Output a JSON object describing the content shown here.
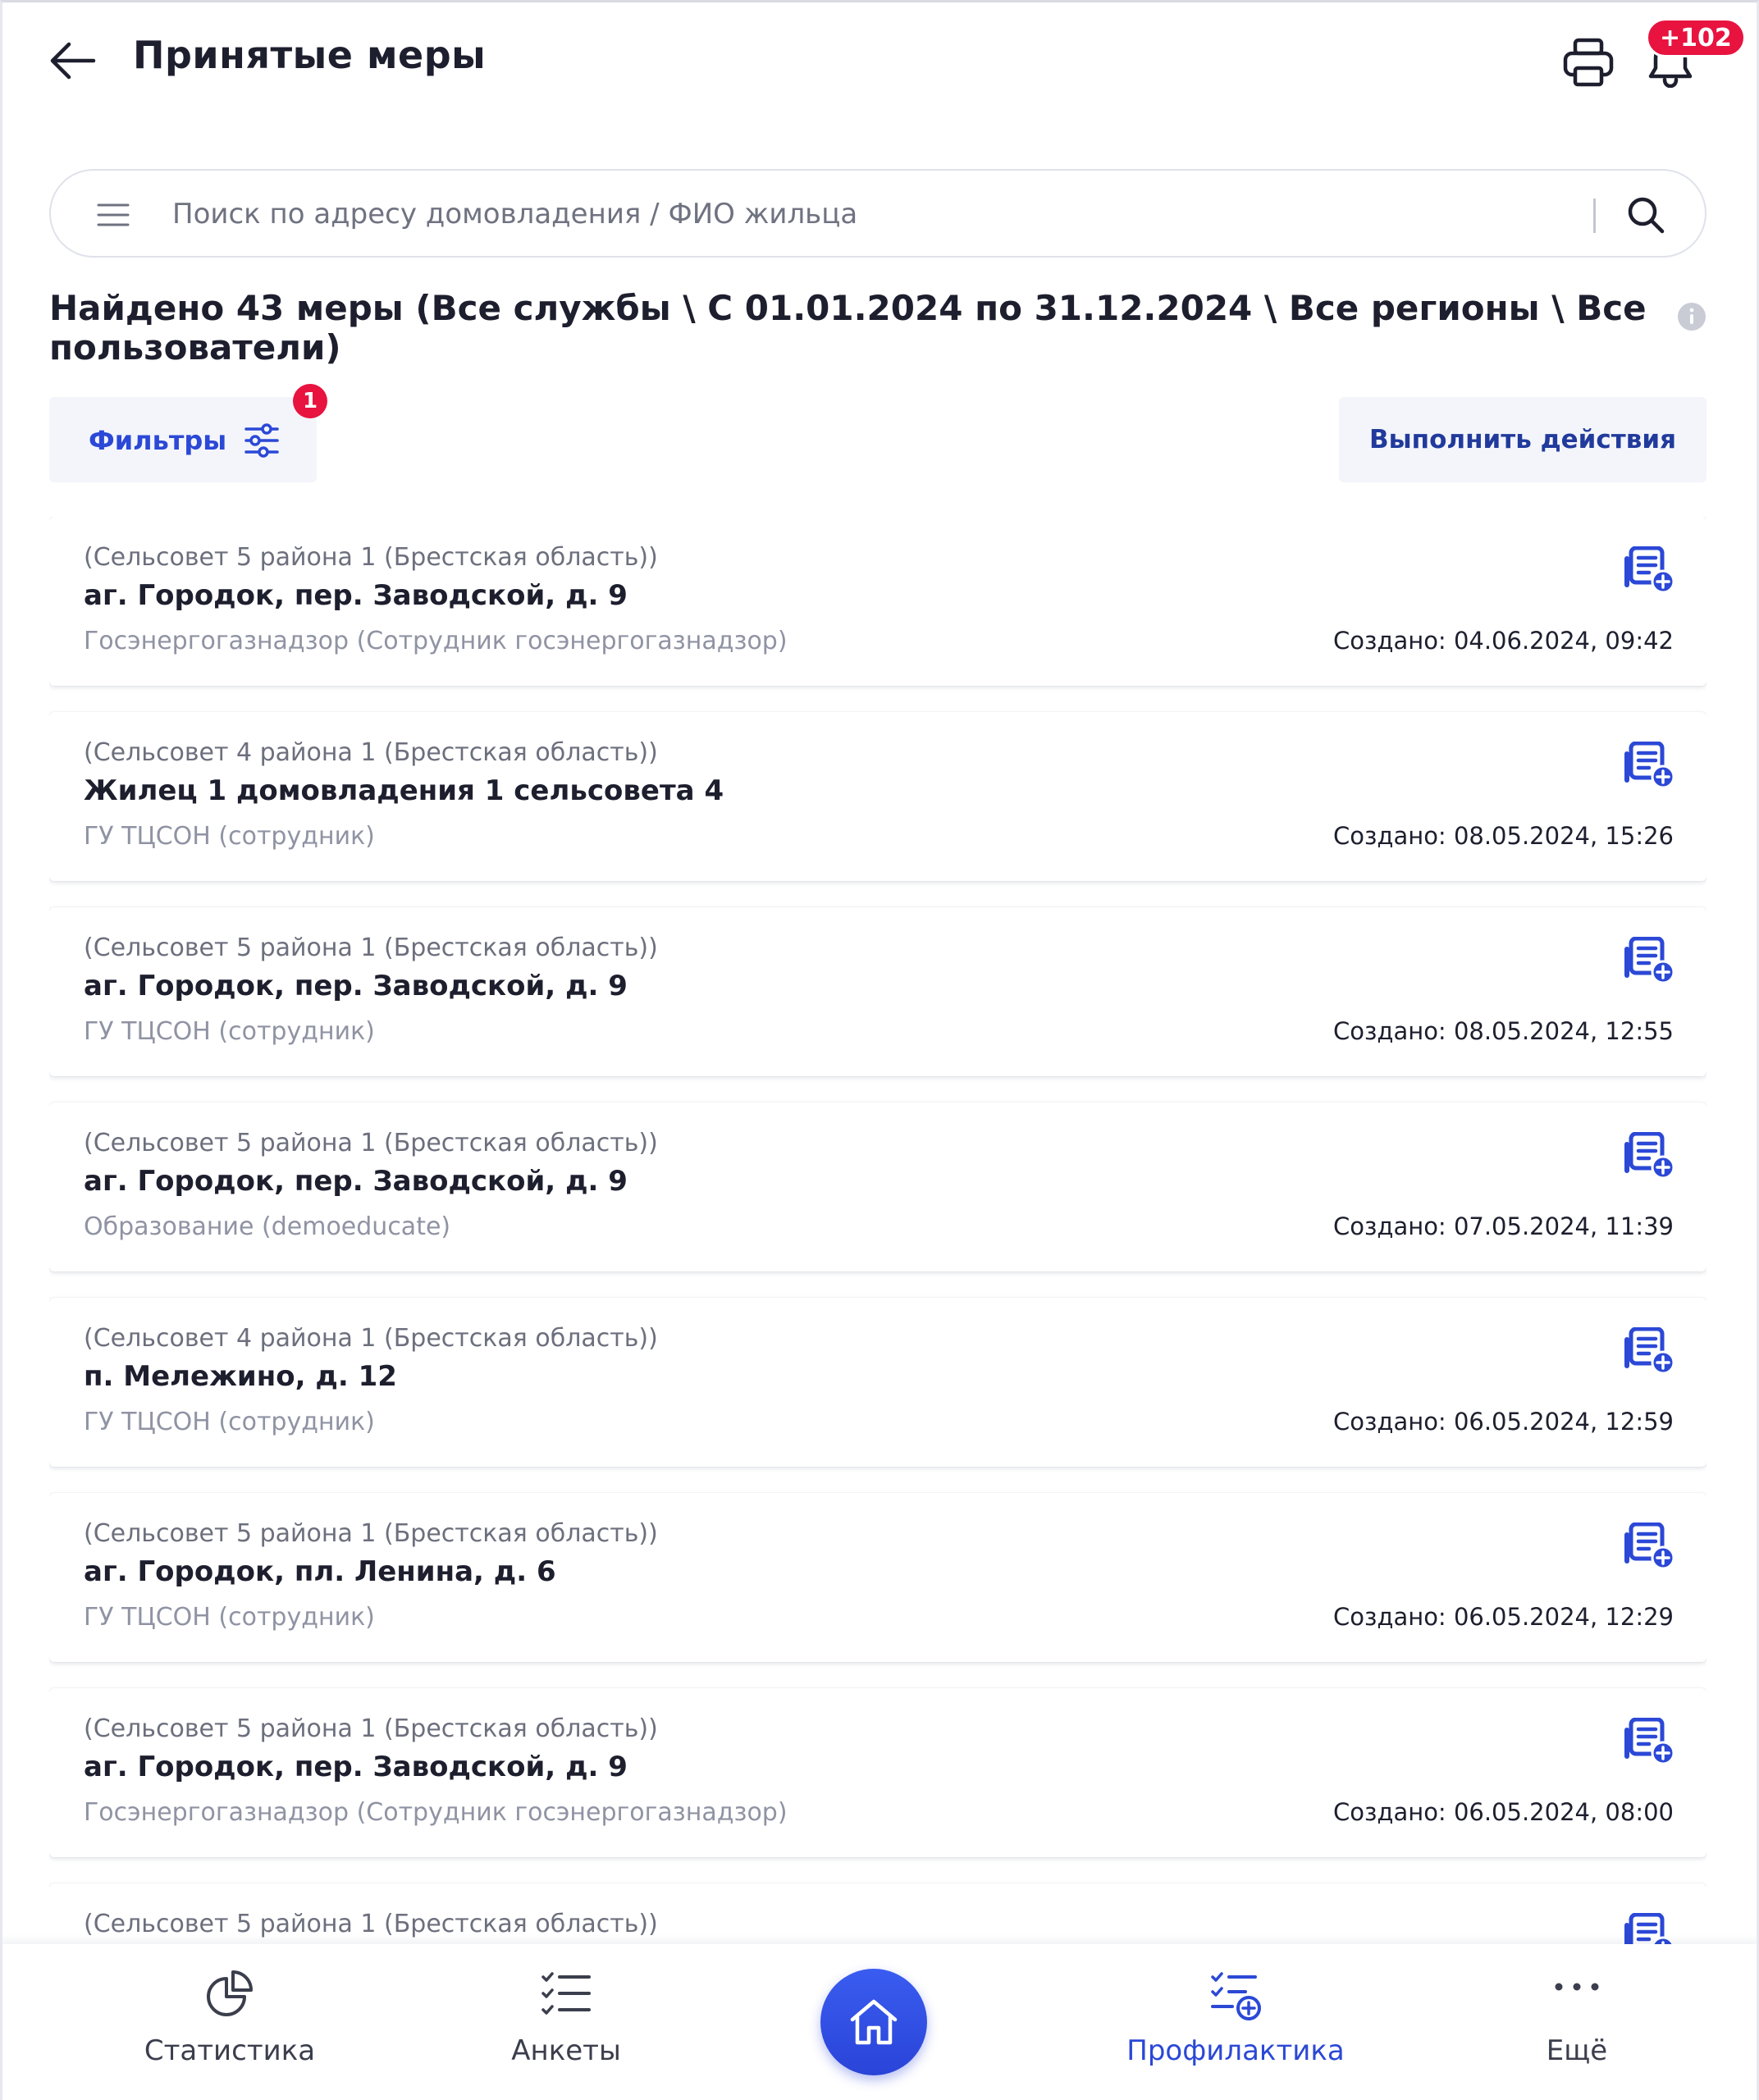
{
  "header": {
    "title": "Принятые меры",
    "notifications_badge": "+102"
  },
  "search": {
    "placeholder": "Поиск по адресу домовладения / ФИО жильца",
    "value": ""
  },
  "summary": {
    "text": "Найдено 43 меры (Все службы \\ С 01.01.2024 по 31.12.2024 \\ Все регионы \\ Все пользователи)"
  },
  "filters": {
    "label": "Фильтры",
    "badge": "1"
  },
  "actions": {
    "label": "Выполнить действия"
  },
  "cards": [
    {
      "region": "(Сельсовет 5 района 1 (Брестская область))",
      "title": "аг. Городок, пер. Заводской, д. 9",
      "service": "Госэнергогазнадзор (Сотрудник госэнергогазнадзор)",
      "created_label": "Создано:",
      "created": "04.06.2024, 09:42"
    },
    {
      "region": "(Сельсовет 4 района 1 (Брестская область))",
      "title": "Жилец 1 домовладения 1 сельсовета 4",
      "service": "ГУ ТЦСОН (сотрудник)",
      "created_label": "Создано:",
      "created": "08.05.2024, 15:26"
    },
    {
      "region": "(Сельсовет 5 района 1 (Брестская область))",
      "title": "аг. Городок, пер. Заводской, д. 9",
      "service": "ГУ ТЦСОН (сотрудник)",
      "created_label": "Создано:",
      "created": "08.05.2024, 12:55"
    },
    {
      "region": "(Сельсовет 5 района 1 (Брестская область))",
      "title": "аг. Городок, пер. Заводской, д. 9",
      "service": "Образование (demoeducate)",
      "created_label": "Создано:",
      "created": "07.05.2024, 11:39"
    },
    {
      "region": "(Сельсовет 4 района 1 (Брестская область))",
      "title": "п. Мележино, д. 12",
      "service": "ГУ ТЦСОН (сотрудник)",
      "created_label": "Создано:",
      "created": "06.05.2024, 12:59"
    },
    {
      "region": "(Сельсовет 5 района 1 (Брестская область))",
      "title": "аг. Городок, пл. Ленина, д. 6",
      "service": "ГУ ТЦСОН (сотрудник)",
      "created_label": "Создано:",
      "created": "06.05.2024, 12:29"
    },
    {
      "region": "(Сельсовет 5 района 1 (Брестская область))",
      "title": "аг. Городок, пер. Заводской, д. 9",
      "service": "Госэнергогазнадзор (Сотрудник госэнергогазнадзор)",
      "created_label": "Создано:",
      "created": "06.05.2024, 08:00"
    },
    {
      "region": "(Сельсовет 5 района 1 (Брестская область))",
      "title": "",
      "service": "",
      "created_label": "",
      "created": ""
    }
  ],
  "nav": {
    "statistics": "Статистика",
    "surveys": "Анкеты",
    "prevention": "Профилактика",
    "more": "Ещё"
  },
  "colors": {
    "accent": "#2b48d6",
    "badge": "#e8133f",
    "text": "#1d1f2e",
    "muted": "#8f93a3"
  },
  "icons": {
    "back": "arrow-left-icon",
    "print": "printer-icon",
    "bell": "bell-icon",
    "menu": "hamburger-menu-icon",
    "search": "search-icon",
    "info": "info-icon",
    "filters": "sliders-icon",
    "card_action": "list-add-icon",
    "statistics": "pie-chart-icon",
    "surveys": "checklist-icon",
    "home": "home-icon",
    "prevention": "checklist-add-icon",
    "more": "more-dots-icon"
  }
}
